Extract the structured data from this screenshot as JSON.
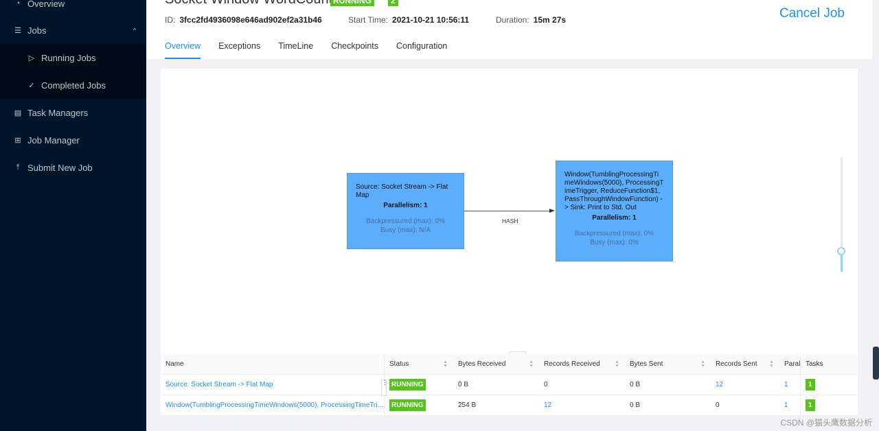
{
  "sidebar": {
    "overview": "Overview",
    "jobs": "Jobs",
    "running": "Running Jobs",
    "completed": "Completed Jobs",
    "taskmanagers": "Task Managers",
    "jobmanager": "Job Manager",
    "submit": "Submit New Job"
  },
  "header": {
    "title": "Socket Window WordCount",
    "status": "RUNNING",
    "count": "2",
    "id_label": "ID:",
    "id": "3fcc2fd4936098e646ad902ef2a31b46",
    "start_label": "Start Time:",
    "start": "2021-10-21 10:56:11",
    "dur_label": "Duration:",
    "duration": "15m 27s",
    "cancel": "Cancel Job"
  },
  "tabs": [
    "Overview",
    "Exceptions",
    "TimeLine",
    "Checkpoints",
    "Configuration"
  ],
  "graph": {
    "nodes": [
      {
        "name": "Source: Socket Stream -> Flat Map",
        "par": "Parallelism: 1",
        "bp": "Backpressured (max): 0%",
        "busy": "Busy (max): N/A"
      },
      {
        "name": "Window(TumblingProcessingTimeWindows(5000), ProcessingTimeTrigger, ReduceFunction$1, PassThroughWindowFunction) -> Sink: Print to Std. Out",
        "par": "Parallelism: 1",
        "bp": "Backpressured (max): 0%",
        "busy": "Busy (max): 0%"
      }
    ],
    "edge": "HASH"
  },
  "table": {
    "headers": [
      "Name",
      "Status",
      "Bytes Received",
      "Records Received",
      "Bytes Sent",
      "Records Sent",
      "Parallelism",
      "Tasks"
    ],
    "rows": [
      [
        "Source: Socket Stream -> Flat Map",
        "RUNNING",
        "0 B",
        "0",
        "0 B",
        "12",
        "1",
        "1"
      ],
      [
        "Window(TumblingProcessingTimeWindows(5000), ProcessingTimeTri...",
        "RUNNING",
        "254 B",
        "12",
        "0 B",
        "0",
        "1",
        "1"
      ]
    ]
  },
  "watermark": "CSDN @猫头鹰数据分析"
}
